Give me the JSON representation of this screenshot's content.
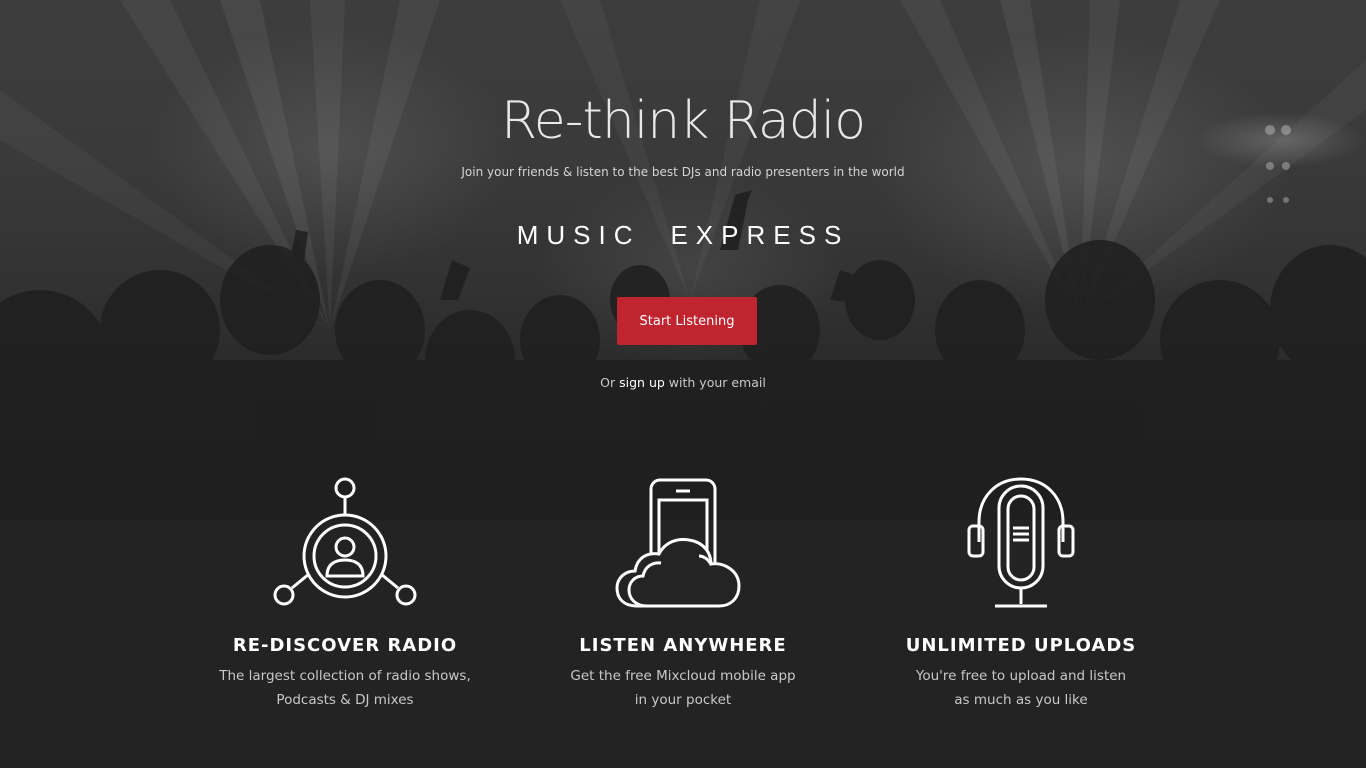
{
  "hero": {
    "title": "Re-think Radio",
    "subtitle": "Join your friends & listen to the best DJs and radio presenters in the world",
    "brand_word_1": "MUSIC",
    "brand_word_2": "EXPRESS",
    "cta_label": "Start Listening",
    "signup_prefix": "Or",
    "signup_link": "sign up",
    "signup_suffix": "with your email"
  },
  "features": [
    {
      "icon": "network-user-icon",
      "title": "RE-DISCOVER RADIO",
      "line1": "The largest collection of radio shows,",
      "line2": "Podcasts & DJ mixes"
    },
    {
      "icon": "phone-cloud-icon",
      "title": "LISTEN ANYWHERE",
      "line1": "Get the free Mixcloud mobile app",
      "line2": "in your pocket"
    },
    {
      "icon": "microphone-headphones-icon",
      "title": "UNLIMITED UPLOADS",
      "line1": "You're free to upload and listen",
      "line2": "as much as you like"
    }
  ],
  "colors": {
    "background": "#232323",
    "accent": "#c0242e",
    "text": "#ffffff",
    "muted_text": "#c8c8c8"
  }
}
